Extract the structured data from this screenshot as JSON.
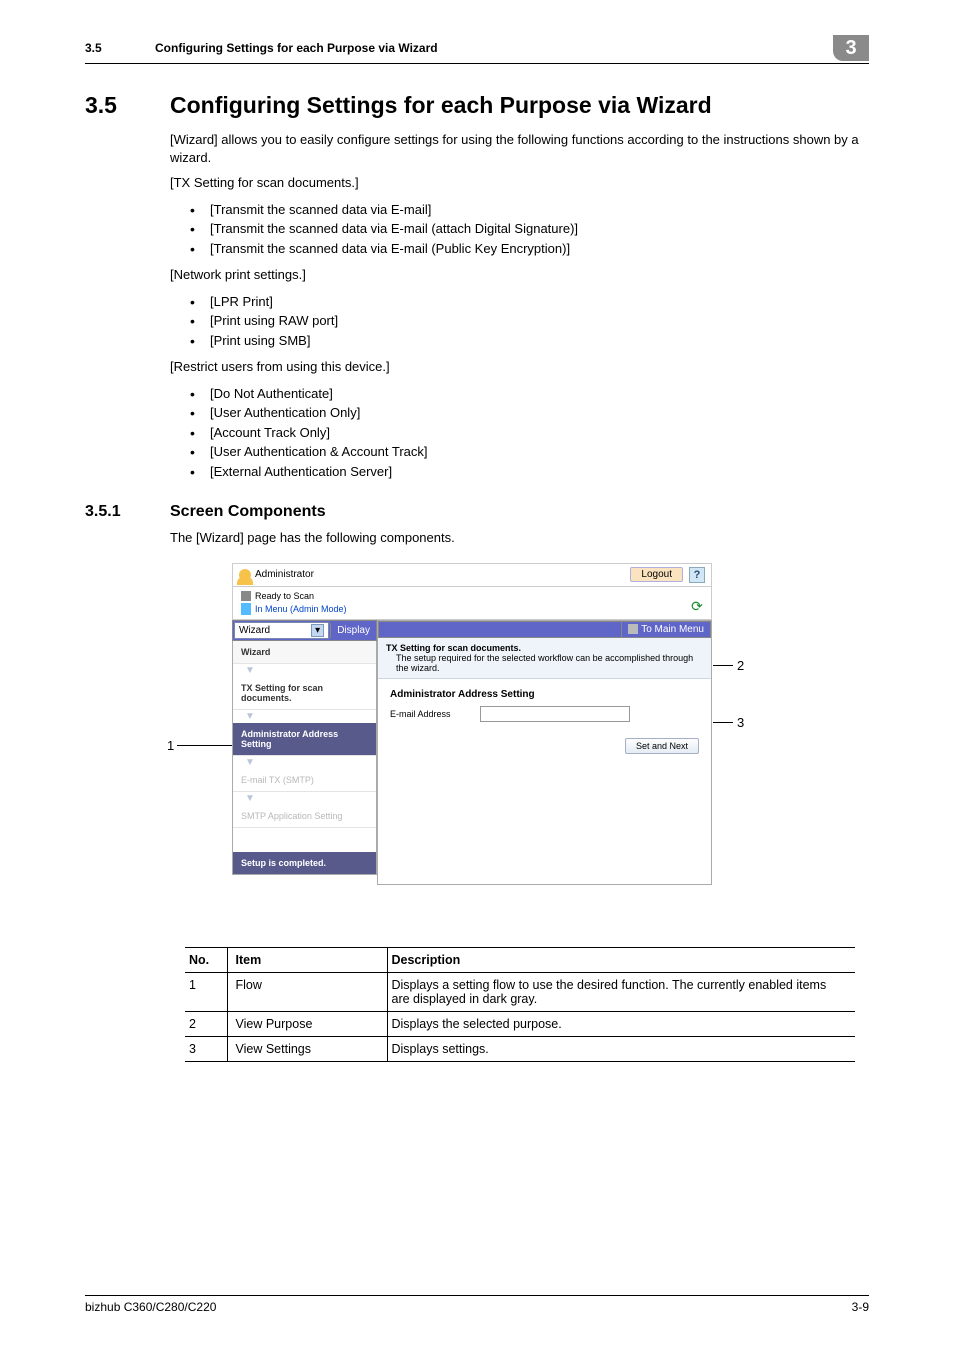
{
  "running_header": {
    "section_number": "3.5",
    "section_title": "Configuring Settings for each Purpose via Wizard",
    "chapter_number": "3"
  },
  "heading1": {
    "number": "3.5",
    "title": "Configuring Settings for each Purpose via Wizard"
  },
  "intro_para": "[Wizard] allows you to easily configure settings for using the following functions according to the instructions shown by a wizard.",
  "group1_label": "[TX Setting for scan documents.]",
  "group1_items": [
    "[Transmit the scanned data via E-mail]",
    "[Transmit the scanned data via E-mail (attach Digital Signature)]",
    "[Transmit the scanned data via E-mail (Public Key Encryption)]"
  ],
  "group2_label": "[Network print settings.]",
  "group2_items": [
    "[LPR Print]",
    "[Print using RAW port]",
    "[Print using SMB]"
  ],
  "group3_label": "[Restrict users from using this device.]",
  "group3_items": [
    "[Do Not Authenticate]",
    "[User Authentication Only]",
    "[Account Track Only]",
    "[User Authentication & Account Track]",
    "[External Authentication Server]"
  ],
  "heading2": {
    "number": "3.5.1",
    "title": "Screen Components"
  },
  "heading2_para": "The [Wizard] page has the following components.",
  "callouts": {
    "c1": "1",
    "c2": "2",
    "c3": "3"
  },
  "wizard_shot": {
    "admin_label": "Administrator",
    "logout": "Logout",
    "help": "?",
    "ready": "Ready to Scan",
    "menu_mode": "In Menu (Admin Mode)",
    "wizard_select": "Wizard",
    "select_caret": "▾",
    "display_btn": "Display",
    "tomain_btn": "To Main Menu",
    "tomain_icon": "▣",
    "flow": {
      "header": "Wizard",
      "step1": "TX Setting for scan documents.",
      "step2": "Administrator Address Setting",
      "step3": "E-mail TX (SMTP)",
      "step4": "SMTP Application Setting",
      "done": "Setup is completed."
    },
    "arrow": "▼",
    "refresh": "⟳",
    "banner_title": "TX Setting for scan documents.",
    "banner_sub": "The setup required for the selected workflow can be accomplished through the wizard.",
    "group_title": "Administrator Address Setting",
    "field_label": "E-mail Address",
    "field_value": "",
    "set_next": "Set and Next"
  },
  "table": {
    "headers": {
      "no": "No.",
      "item": "Item",
      "desc": "Description"
    },
    "rows": [
      {
        "no": "1",
        "item": "Flow",
        "desc": "Displays a setting flow to use the desired function. The currently enabled items are displayed in dark gray."
      },
      {
        "no": "2",
        "item": "View Purpose",
        "desc": "Displays the selected purpose."
      },
      {
        "no": "3",
        "item": "View Settings",
        "desc": "Displays settings."
      }
    ]
  },
  "footer": {
    "product": "bizhub C360/C280/C220",
    "page": "3-9"
  }
}
